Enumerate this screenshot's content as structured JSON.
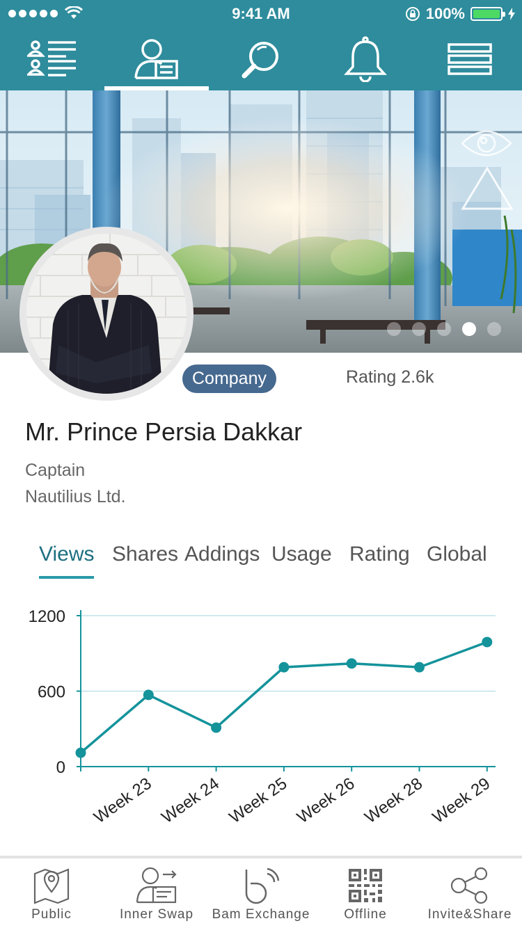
{
  "status_bar": {
    "time": "9:41 AM",
    "battery": "100%",
    "battery_level": 1.0,
    "signal_bars": 5
  },
  "top_nav": {
    "tabs": [
      {
        "icon": "contact-list-icon"
      },
      {
        "icon": "profile-card-icon",
        "active": true
      },
      {
        "icon": "search-icon"
      },
      {
        "icon": "bell-icon"
      },
      {
        "icon": "menu-icon"
      }
    ]
  },
  "hero": {
    "carousel_total": 5,
    "carousel_active": 4
  },
  "profile": {
    "badge": "Company",
    "rating": "Rating 2.6k",
    "name": "Mr. Prince Persia Dakkar",
    "role": "Captain",
    "company": "Nautilius Ltd."
  },
  "stat_tabs": [
    "Views",
    "Shares",
    "Addings",
    "Usage",
    "Rating",
    "Global"
  ],
  "stat_tab_active": "Views",
  "chart_data": {
    "type": "line",
    "categories": [
      "",
      "Week 23",
      "Week 24",
      "Week 25",
      "Week 26",
      "Week 28",
      "Week 29"
    ],
    "values": [
      110,
      570,
      310,
      790,
      820,
      790,
      990
    ],
    "ylim": [
      0,
      1200
    ],
    "yticks": [
      "1200",
      "600",
      "0"
    ],
    "grid": true,
    "color": "#14939b"
  },
  "bottom_nav": {
    "items": [
      {
        "label": "Public",
        "icon": "map-pin-icon"
      },
      {
        "label": "Inner Swap",
        "icon": "card-swap-icon"
      },
      {
        "label": "Bam Exchange",
        "icon": "bam-logo-icon"
      },
      {
        "label": "Offline",
        "icon": "qr-code-icon"
      },
      {
        "label": "Invite&Share",
        "icon": "share-icon"
      }
    ]
  }
}
